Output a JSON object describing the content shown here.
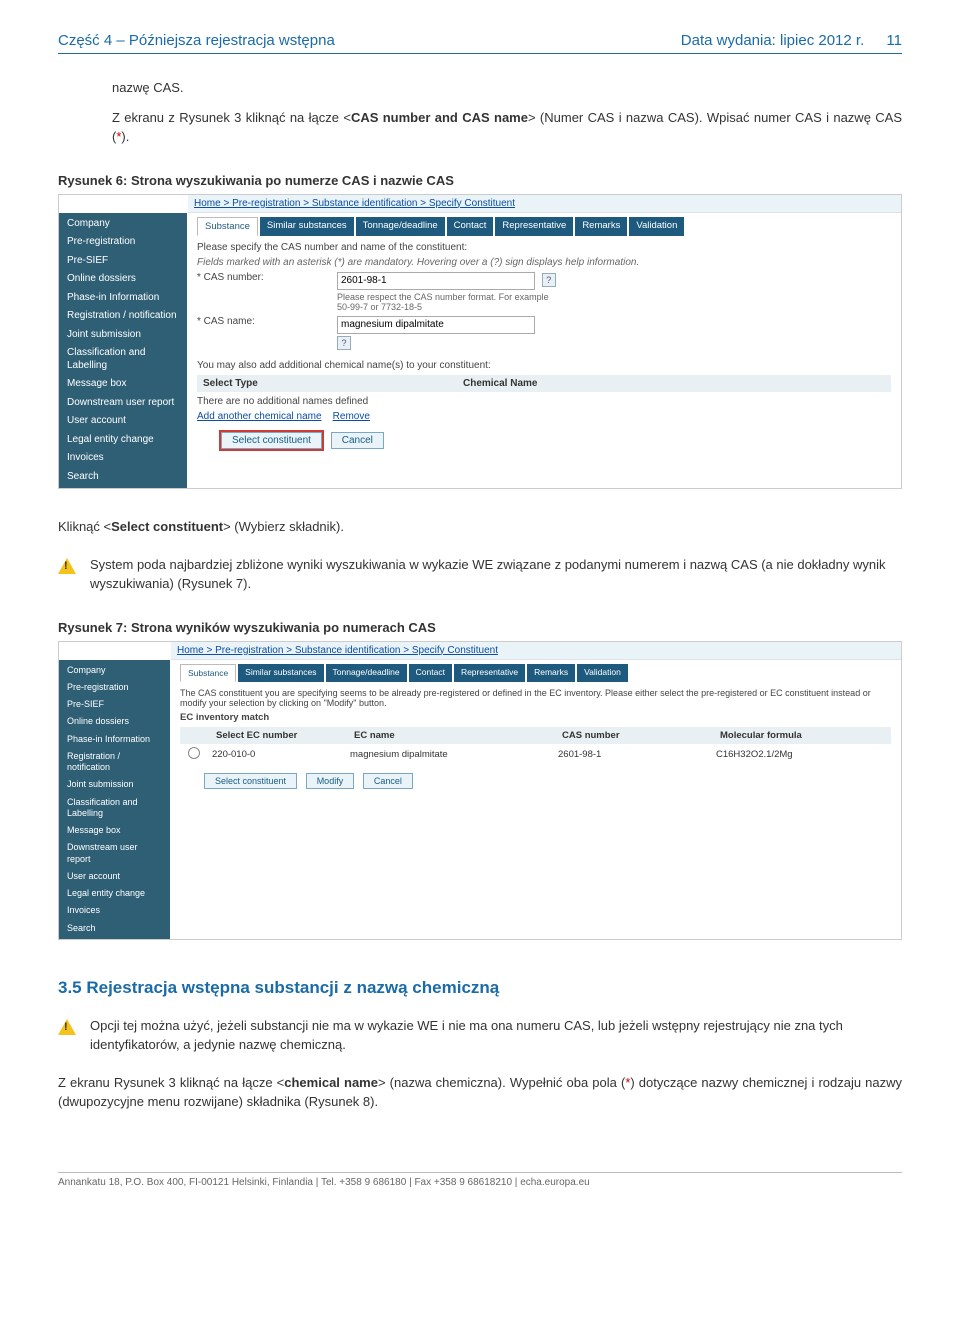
{
  "header": {
    "left": "Część 4 – Późniejsza rejestracja wstępna",
    "right_label": "Data wydania: lipiec 2012 r.",
    "page_num": "11"
  },
  "p_nazwe_cas": "nazwę CAS.",
  "p_intro_1a": "Z ekranu z Rysunek 3 kliknąć na łącze <",
  "p_intro_1b": "CAS number and CAS name",
  "p_intro_1c": "> (Numer CAS i nazwa CAS). Wpisać numer CAS i nazwę CAS (",
  "p_intro_1d": ").",
  "fig6_title": "Rysunek 6: Strona wyszukiwania po numerze CAS i nazwie CAS",
  "ss": {
    "breadcrumb": "Home > Pre-registration > Substance identification > Specify Constituent",
    "sidebar": [
      "Company",
      "Pre-registration",
      "Pre-SIEF",
      "Online dossiers",
      "Phase-in Information",
      "Registration / notification",
      "Joint submission",
      "Classification and Labelling",
      "Message box",
      "Downstream user report",
      "User account",
      "Legal entity change",
      "Invoices",
      "Search"
    ],
    "tabs": [
      "Substance",
      "Similar substances",
      "Tonnage/deadline",
      "Contact",
      "Representative",
      "Remarks",
      "Validation"
    ],
    "prompt": "Please specify the CAS number and name of the constituent:",
    "note_italic": "Fields marked with an asterisk (*) are mandatory. Hovering over a (?) sign displays help information.",
    "row1_label": "* CAS number:",
    "row1_value": "2601-98-1",
    "row1_hint": "Please respect the CAS number format. For example 50-99-7 or 7732-18-5",
    "row2_label": "* CAS name:",
    "row2_value": "magnesium dipalmitate",
    "line_addl": "You may also add additional chemical name(s) to your constituent:",
    "th_col1": "Select Type",
    "th_col2": "Chemical Name",
    "no_names": "There are no additional names defined",
    "link_add": "Add another chemical name",
    "link_remove": "Remove",
    "btn_select": "Select constituent",
    "btn_cancel": "Cancel"
  },
  "p_click_a": "Kliknąć <",
  "p_click_b": "Select constituent",
  "p_click_c": "> (Wybierz składnik).",
  "warn1": "System poda najbardziej zbliżone wyniki wyszukiwania w wykazie WE związane z podanymi numerem i nazwą CAS (a nie dokładny wynik wyszukiwania) (Rysunek 7).",
  "fig7_title": "Rysunek 7: Strona wyników wyszukiwania po numerach CAS",
  "ss2": {
    "desc": "The CAS constituent you are specifying seems to be already pre-registered or defined in the EC inventory. Please either select the pre-registered or EC constituent instead or modify your selection by clicking on \"Modify\" button.",
    "match_label": "EC inventory match",
    "headers": [
      "",
      "Select EC number",
      "EC name",
      "CAS number",
      "Molecular formula"
    ],
    "row": [
      "",
      "220-010-0",
      "magnesium dipalmitate",
      "2601-98-1",
      "C16H32O2.1/2Mg"
    ],
    "btn_select": "Select constituent",
    "btn_modify": "Modify",
    "btn_cancel": "Cancel"
  },
  "h3_5": "3.5 Rejestracja wstępna substancji z nazwą chemiczną",
  "warn2": "Opcji tej można użyć, jeżeli substancji nie ma w wykazie WE i nie ma ona numeru CAS, lub jeżeli wstępny rejestrujący nie zna tych identyfikatorów, a jedynie nazwę chemiczną.",
  "p_last_a": "Z ekranu Rysunek 3 kliknąć na łącze <",
  "p_last_b": "chemical name",
  "p_last_c": "> (nazwa chemiczna). Wypełnić oba pola (",
  "p_last_d": ") dotyczące nazwy chemicznej i rodzaju nazwy (dwupozycyjne menu rozwijane) składnika (Rysunek 8).",
  "star": "*",
  "footer": "Annankatu 18, P.O. Box 400, FI-00121 Helsinki, Finlandia | Tel. +358 9 686180 | Fax +358 9 68618210 | echa.europa.eu"
}
